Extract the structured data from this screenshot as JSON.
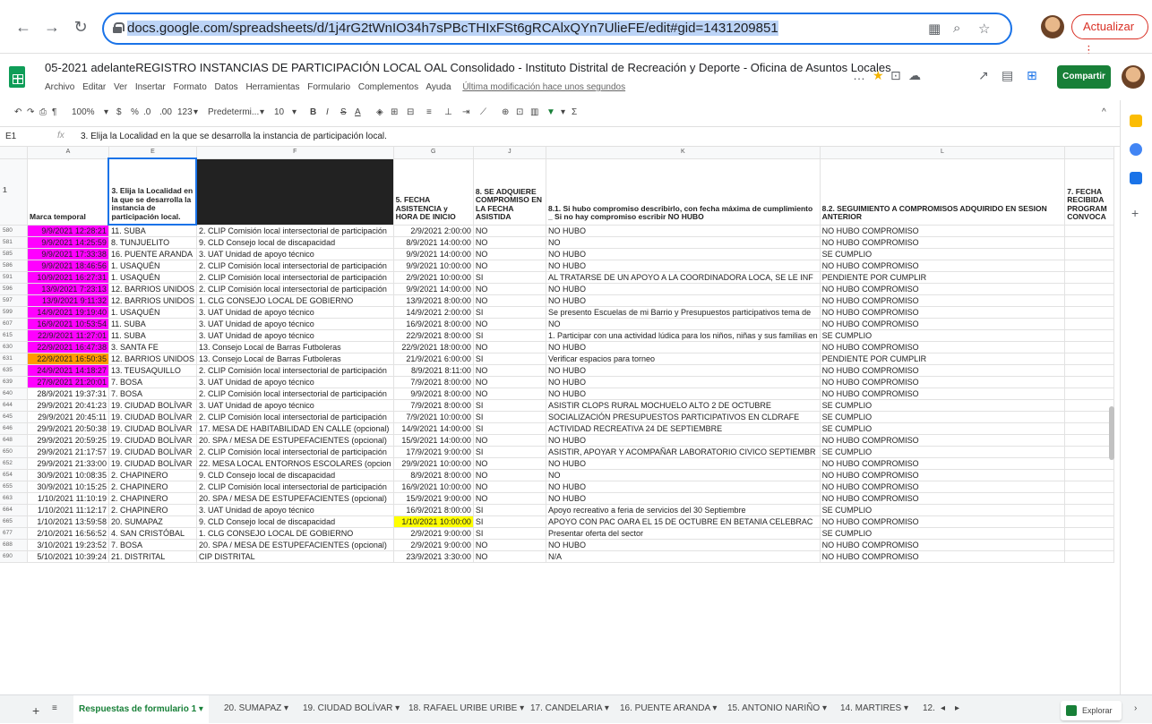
{
  "browser": {
    "url_host": "docs.google.com",
    "url_path": "/spreadsheets/d/1j4rG2tWnIO34h7sPBcTHIxFSt6gRCAlxQYn7UlieFE/edit#gid=1431209851",
    "update_label": "Actualizar"
  },
  "doc": {
    "title": "05-2021 adelanteREGISTRO INSTANCIAS DE PARTICIPACIÓN LOCAL OAL Consolidado -  Instituto Distrital de Recreación y Deporte - Oficina de Asuntos Locales",
    "share_label": "Compartir",
    "last_modified": "Última modificación hace unos segundos",
    "menu": [
      "Archivo",
      "Editar",
      "Ver",
      "Insertar",
      "Formato",
      "Datos",
      "Herramientas",
      "Formulario",
      "Complementos",
      "Ayuda"
    ]
  },
  "toolbar": {
    "zoom": "100%",
    "currency": "$",
    "percent": "%",
    "dec_less": ".0",
    "dec_more": ".00",
    "format_num": "123",
    "font": "Predetermi...",
    "font_size": "10"
  },
  "formula": {
    "cell_ref": "E1",
    "value": "3. Elija la Localidad en la que se desarrolla la instancia de participación local."
  },
  "columns": [
    "A",
    "E",
    "F",
    "G",
    "J",
    "K",
    "L"
  ],
  "headers": [
    "Marca temporal",
    "3. Elija la Localidad en la que se desarrolla la instancia de participación local.",
    "",
    "5. FECHA ASISTENCIA y HORA DE INICIO",
    "8. SE ADQUIERE COMPROMISO EN LA FECHA ASISTIDA",
    "8.1. Si hubo compromiso describirlo, con fecha máxima de cumplimiento  _ Si no hay compromiso escribir NO HUBO",
    "8.2. SEGUIMIENTO A COMPROMISOS ADQUIRIDO EN SESION ANTERIOR",
    "7. FECHA RECIBIDA PROGRAM CONVOCA"
  ],
  "rows": [
    {
      "n": "580",
      "a": "9/9/2021 12:28:21",
      "e": "11. SUBA",
      "f": "2. CLIP Comisión local intersectorial de participación",
      "g": "2/9/2021 2:00:00",
      "j": "NO",
      "k": "NO HUBO",
      "l": "NO HUBO COMPROMISO",
      "ca": "pink"
    },
    {
      "n": "581",
      "a": "9/9/2021 14:25:59",
      "e": "8. TUNJUELITO",
      "f": "9. CLD Consejo local de discapacidad",
      "g": "8/9/2021 14:00:00",
      "j": "NO",
      "k": "NO",
      "l": "NO HUBO COMPROMISO",
      "ca": "pink"
    },
    {
      "n": "585",
      "a": "9/9/2021 17:33:38",
      "e": "16. PUENTE ARANDA",
      "f": "3. UAT Unidad de apoyo técnico",
      "g": "9/9/2021 14:00:00",
      "j": "NO",
      "k": "NO HUBO",
      "l": "SE CUMPLIO",
      "ca": "pink"
    },
    {
      "n": "586",
      "a": "9/9/2021 18:46:56",
      "e": "1. USAQUÉN",
      "f": "2. CLIP Comisión local intersectorial de participación",
      "g": "9/9/2021 10:00:00",
      "j": "NO",
      "k": "NO HUBO",
      "l": "NO HUBO COMPROMISO",
      "ca": "pink"
    },
    {
      "n": "591",
      "a": "10/9/2021 16:27:31",
      "e": "1. USAQUÉN",
      "f": "2. CLIP Comisión local intersectorial de participación",
      "g": "2/9/2021 10:00:00",
      "j": "SI",
      "k": "AL TRATARSE DE UN APOYO A LA COORDINADORA LOCA, SE LE INF",
      "l": "PENDIENTE POR  CUMPLIR",
      "ca": "pink"
    },
    {
      "n": "596",
      "a": "13/9/2021 7:23:13",
      "e": "12. BARRIOS UNIDOS",
      "f": "2. CLIP Comisión local intersectorial de participación",
      "g": "9/9/2021 14:00:00",
      "j": "NO",
      "k": "NO HUBO",
      "l": "NO HUBO COMPROMISO",
      "ca": "pink"
    },
    {
      "n": "597",
      "a": "13/9/2021 9:11:32",
      "e": "12. BARRIOS UNIDOS",
      "f": "1. CLG  CONSEJO LOCAL DE GOBIERNO",
      "g": "13/9/2021 8:00:00",
      "j": "NO",
      "k": "NO HUBO",
      "l": "NO HUBO COMPROMISO",
      "ca": "pink"
    },
    {
      "n": "599",
      "a": "14/9/2021 19:19:40",
      "e": "1. USAQUÉN",
      "f": "3. UAT Unidad de apoyo técnico",
      "g": "14/9/2021 2:00:00",
      "j": "SI",
      "k": "Se presento Escuelas de mi Barrio y Presupuestos participativos tema de",
      "l": "NO HUBO COMPROMISO",
      "ca": "pink"
    },
    {
      "n": "607",
      "a": "16/9/2021 10:53:54",
      "e": "11. SUBA",
      "f": "3. UAT Unidad de apoyo técnico",
      "g": "16/9/2021 8:00:00",
      "j": "NO",
      "k": "NO",
      "l": "NO HUBO COMPROMISO",
      "ca": "pink"
    },
    {
      "n": "615",
      "a": "22/9/2021 11:27:01",
      "e": "11. SUBA",
      "f": "3. UAT Unidad de apoyo técnico",
      "g": "22/9/2021 8:00:00",
      "j": "SI",
      "k": "1. Participar con una actividad lúdica para los niños, niñas y sus familias en",
      "l": "SE CUMPLIO",
      "ca": "pink"
    },
    {
      "n": "630",
      "a": "22/9/2021 16:47:38",
      "e": "3. SANTA FE",
      "f": "13. Consejo Local de Barras Futboleras",
      "g": "22/9/2021 18:00:00",
      "j": "NO",
      "k": "NO HUBO",
      "l": "NO HUBO COMPROMISO",
      "ca": "pink"
    },
    {
      "n": "631",
      "a": "22/9/2021 16:50:35",
      "e": "12. BARRIOS UNIDOS",
      "f": "13. Consejo Local de Barras Futboleras",
      "g": "21/9/2021 6:00:00",
      "j": "SI",
      "k": "Verificar espacios para torneo",
      "l": "PENDIENTE POR  CUMPLIR",
      "ca": "orange"
    },
    {
      "n": "635",
      "a": "24/9/2021 14:18:27",
      "e": "13. TEUSAQUILLO",
      "f": "2. CLIP Comisión local intersectorial de participación",
      "g": "8/9/2021 8:11:00",
      "j": "NO",
      "k": "NO HUBO",
      "l": "NO HUBO COMPROMISO",
      "ca": "pink"
    },
    {
      "n": "639",
      "a": "27/9/2021 21:20:01",
      "e": "7. BOSA",
      "f": "3. UAT Unidad de apoyo técnico",
      "g": "7/9/2021 8:00:00",
      "j": "NO",
      "k": "NO HUBO",
      "l": "NO HUBO COMPROMISO",
      "ca": "pink"
    },
    {
      "n": "640",
      "a": "28/9/2021 19:37:31",
      "e": "7. BOSA",
      "f": "2. CLIP Comisión local intersectorial de participación",
      "g": "9/9/2021 8:00:00",
      "j": "NO",
      "k": "NO HUBO",
      "l": "NO HUBO COMPROMISO",
      "ca": ""
    },
    {
      "n": "644",
      "a": "29/9/2021 20:41:23",
      "e": "19. CIUDAD BOLÍVAR",
      "f": "3. UAT Unidad de apoyo técnico",
      "g": "7/9/2021 8:00:00",
      "j": "SI",
      "k": "ASISTIR CLOPS RURAL MOCHUELO ALTO 2 DE OCTUBRE",
      "l": "SE CUMPLIO",
      "ca": ""
    },
    {
      "n": "645",
      "a": "29/9/2021 20:45:11",
      "e": "19. CIUDAD BOLÍVAR",
      "f": "2. CLIP Comisión local intersectorial de participación",
      "g": "7/9/2021 10:00:00",
      "j": "SI",
      "k": "SOCIALIZACIÓN PRESUPUESTOS PARTICIPATIVOS EN CLDRAFE",
      "l": "SE CUMPLIO",
      "ca": ""
    },
    {
      "n": "646",
      "a": "29/9/2021 20:50:38",
      "e": "19. CIUDAD BOLÍVAR",
      "f": "17. MESA DE HABITABILIDAD EN CALLE (opcional)",
      "g": "14/9/2021 14:00:00",
      "j": "SI",
      "k": "ACTIVIDAD RECREATIVA 24 DE SEPTIEMBRE",
      "l": "SE CUMPLIO",
      "ca": ""
    },
    {
      "n": "648",
      "a": "29/9/2021 20:59:25",
      "e": "19. CIUDAD BOLÍVAR",
      "f": "20. SPA / MESA DE ESTUPEFACIENTES (opcional)",
      "g": "15/9/2021 14:00:00",
      "j": "NO",
      "k": "NO HUBO",
      "l": "NO HUBO COMPROMISO",
      "ca": ""
    },
    {
      "n": "650",
      "a": "29/9/2021 21:17:57",
      "e": "19. CIUDAD BOLÍVAR",
      "f": "2. CLIP Comisión local intersectorial de participación",
      "g": "17/9/2021 9:00:00",
      "j": "SI",
      "k": "ASISTIR, APOYAR Y ACOMPAÑAR LABORATORIO CIVICO SEPTIEMBR",
      "l": "SE CUMPLIO",
      "ca": ""
    },
    {
      "n": "652",
      "a": "29/9/2021 21:33:00",
      "e": "19. CIUDAD BOLÍVAR",
      "f": "22. MESA LOCAL ENTORNOS ESCOLARES (opcion",
      "g": "29/9/2021 10:00:00",
      "j": "NO",
      "k": "NO HUBO",
      "l": "NO HUBO COMPROMISO",
      "ca": ""
    },
    {
      "n": "654",
      "a": "30/9/2021 10:08:35",
      "e": "2. CHAPINERO",
      "f": "9. CLD Consejo local de discapacidad",
      "g": "8/9/2021 8:00:00",
      "j": "NO",
      "k": "NO",
      "l": "NO HUBO COMPROMISO",
      "ca": ""
    },
    {
      "n": "655",
      "a": "30/9/2021 10:15:25",
      "e": "2. CHAPINERO",
      "f": "2. CLIP Comisión local intersectorial de participación",
      "g": "16/9/2021 10:00:00",
      "j": "NO",
      "k": "NO HUBO",
      "l": "NO HUBO COMPROMISO",
      "ca": ""
    },
    {
      "n": "663",
      "a": "1/10/2021 11:10:19",
      "e": "2. CHAPINERO",
      "f": "20. SPA / MESA DE ESTUPEFACIENTES (opcional)",
      "g": "15/9/2021 9:00:00",
      "j": "NO",
      "k": "NO HUBO",
      "l": "NO HUBO COMPROMISO",
      "ca": ""
    },
    {
      "n": "664",
      "a": "1/10/2021 11:12:17",
      "e": "2. CHAPINERO",
      "f": "3. UAT Unidad de apoyo técnico",
      "g": "16/9/2021 8:00:00",
      "j": "SI",
      "k": "Apoyo recreativo a feria de servicios del 30 Septiembre",
      "l": "SE CUMPLIO",
      "ca": ""
    },
    {
      "n": "665",
      "a": "1/10/2021 13:59:58",
      "e": "20. SUMAPAZ",
      "f": "9. CLD Consejo local de discapacidad",
      "g": "1/10/2021 10:00:00",
      "j": "SI",
      "k": "APOYO CON PAC OARA EL 15 DE OCTUBRE EN BETANIA CELEBRAC",
      "l": "NO HUBO COMPROMISO",
      "ca": "",
      "cg": "yellow"
    },
    {
      "n": "677",
      "a": "2/10/2021 16:56:52",
      "e": "4. SAN CRISTÓBAL",
      "f": "1. CLG  CONSEJO LOCAL DE GOBIERNO",
      "g": "2/9/2021 9:00:00",
      "j": "SI",
      "k": "Presentar oferta del sector",
      "l": "SE CUMPLIO",
      "ca": ""
    },
    {
      "n": "688",
      "a": "3/10/2021 19:23:52",
      "e": "7. BOSA",
      "f": "20. SPA / MESA DE ESTUPEFACIENTES (opcional)",
      "g": "2/9/2021 9:00:00",
      "j": "NO",
      "k": "NO HUBO",
      "l": "NO HUBO COMPROMISO",
      "ca": ""
    },
    {
      "n": "690",
      "a": "5/10/2021 10:39:24",
      "e": "21. DISTRITAL",
      "f": "CIP DISTRITAL",
      "g": "23/9/2021 3:30:00",
      "j": "NO",
      "k": "N/A",
      "l": "NO HUBO COMPROMISO",
      "ca": ""
    }
  ],
  "tabs": [
    "Respuestas de formulario 1",
    "20. SUMAPAZ",
    "19. CIUDAD BOLÍVAR",
    "18. RAFAEL URIBE URIBE",
    "17. CANDELARIA",
    "16. PUENTE ARANDA",
    "15. ANTONIO NARIÑO",
    "14. MARTIRES",
    "12."
  ],
  "explore_label": "Explorar",
  "colors": {
    "pink": "#ff00ff",
    "orange": "#ff9900",
    "yellow": "#ffff00",
    "accent": "#1a73e8",
    "brand": "#188038"
  }
}
